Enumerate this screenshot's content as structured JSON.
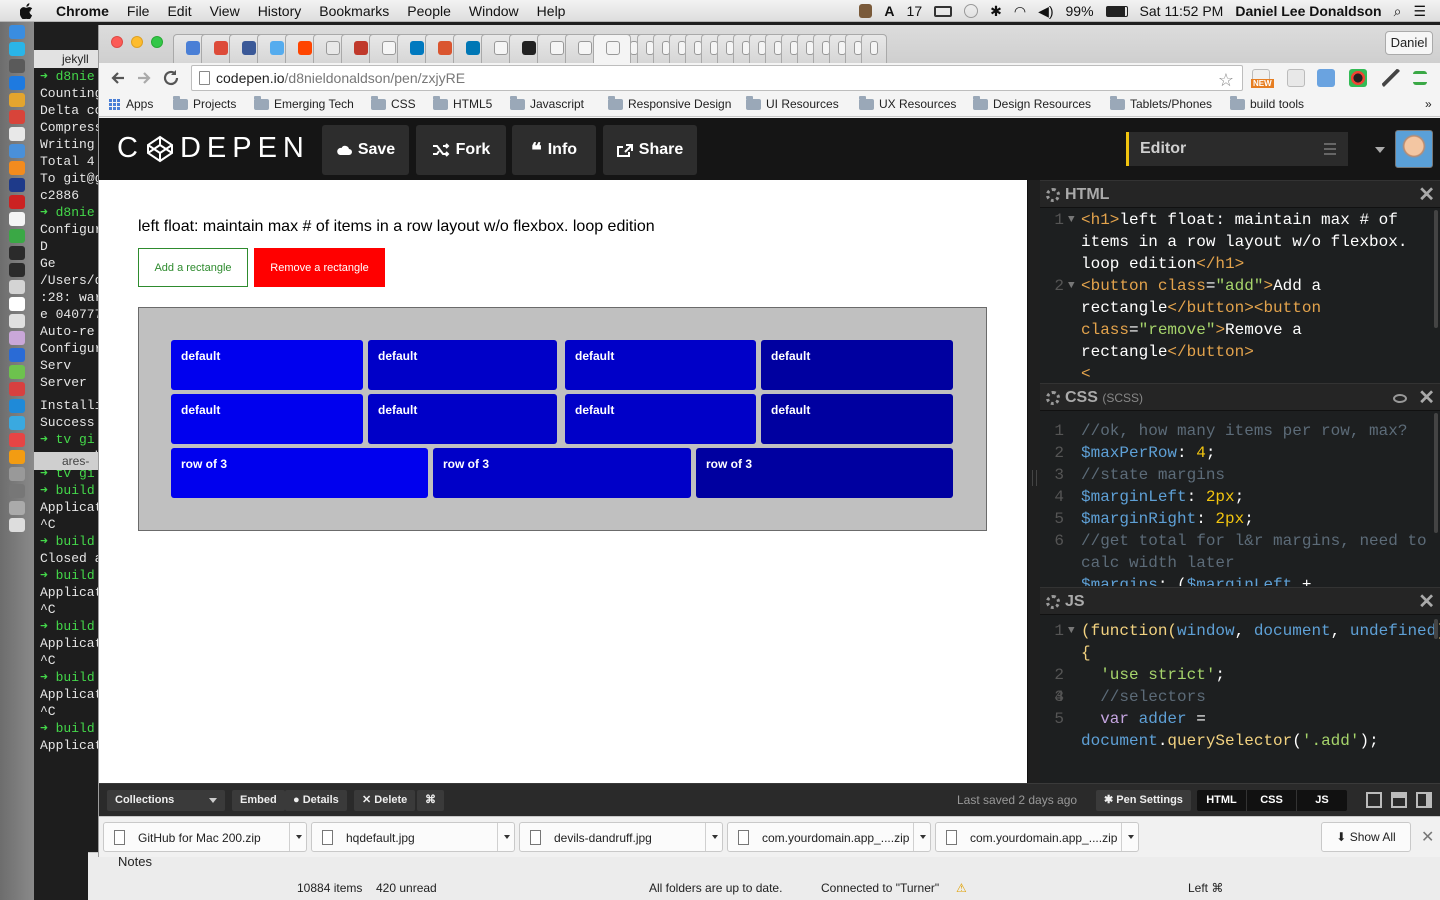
{
  "menubar": {
    "app": "Chrome",
    "items": [
      "File",
      "Edit",
      "View",
      "History",
      "Bookmarks",
      "People",
      "Window",
      "Help"
    ],
    "badge_count": "17",
    "battery": "99%",
    "clock": "Sat 11:52 PM",
    "user": "Daniel Lee Donaldson"
  },
  "terminal": {
    "tab_top": "jekyll",
    "tab_bottom": "ares-",
    "lines_top": [
      "➜ d8nie",
      "Counting",
      "Delta co",
      "Compress",
      "Writing ",
      "Total 4 ",
      "To git@g",
      "   c2886",
      "➜ d8nie",
      "Configur",
      "",
      "       D",
      "      Ge",
      "",
      "/Users/d",
      ":28: war",
      "e 040777",
      "  Auto-re",
      "Configur",
      "     Serv",
      "   Server",
      ""
    ],
    "lines_bottom": [
      "Installi",
      "Success ",
      "➜ tv gi",
      "ares-web",
      "➜ tv gi",
      "➜ build",
      "Applicat",
      "^C",
      "➜ build",
      "Closed a",
      "➜ build",
      "Applicat",
      "^C",
      "➜ build",
      "Applicat",
      "^C",
      "➜ build",
      "Applicat",
      "^C",
      "➜ build",
      "Applicat",
      ""
    ]
  },
  "chrome": {
    "profile": "Daniel",
    "url_host": "codepen.io",
    "url_path": "/d8nieldonaldson/pen/zxjyRE",
    "bookmarks": [
      "Apps",
      "Projects",
      "Emerging Tech",
      "CSS",
      "HTML5",
      "Javascript",
      "Responsive Design",
      "UI Resources",
      "UX Resources",
      "Design Resources",
      "Tablets/Phones",
      "build tools"
    ],
    "ext_new_badge": "NEW"
  },
  "codepen": {
    "logo": "CODEPEN",
    "buttons": {
      "save": "Save",
      "fork": "Fork",
      "info": "Info",
      "share": "Share"
    },
    "editor_selector": "Editor",
    "preview": {
      "heading": "left float: maintain max # of items in a row layout w/o flexbox. loop edition",
      "add_label": "Add a rectangle",
      "remove_label": "Remove a rectangle",
      "rect_labels": [
        "default",
        "default",
        "default",
        "default",
        "default",
        "default",
        "default",
        "default",
        "row of 3",
        "row of 3",
        "row of 3"
      ],
      "colors": {
        "rect_bright": "#0000ee",
        "rect_mid": "#0000c8",
        "rect_dark": "#0000a0",
        "container": "#c0c0c0",
        "add": "#2e8b2e",
        "remove": "#ff0000"
      }
    },
    "panes": {
      "html": {
        "title": "HTML"
      },
      "css": {
        "title": "CSS",
        "sub": "(SCSS)"
      },
      "js": {
        "title": "JS"
      }
    },
    "footer": {
      "collections": "Collections",
      "embed": "Embed",
      "details": "Details",
      "delete": "Delete",
      "shortcut": "⌘",
      "last_saved": "Last saved 2 days ago",
      "pen_settings": "Pen Settings",
      "views": [
        "HTML",
        "CSS",
        "JS"
      ]
    }
  },
  "downloads": {
    "items": [
      "GitHub for Mac 200.zip",
      "hqdefault.jpg",
      "devils-dandruff.jpg",
      "com.yourdomain.app_....zip",
      "com.yourdomain.app_....zip"
    ],
    "show_all": "Show All"
  },
  "finder": {
    "notes": "Notes",
    "items": "10884 items",
    "unread": "420 unread",
    "sync": "All folders are up to date.",
    "connected": "Connected to \"Turner\"",
    "shortcut": "Left ⌘"
  }
}
